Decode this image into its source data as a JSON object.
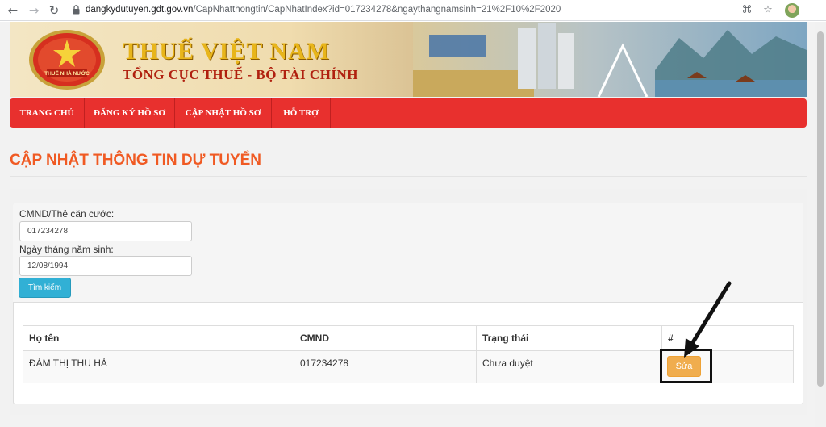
{
  "browser": {
    "url_host": "dangkydutuyen.gdt.gov.vn",
    "url_path": "/CapNhatthongtin/CapNhatIndex?id=017234278&ngaythangnamsinh=21%2F10%2F2020"
  },
  "header": {
    "seal_text": "THUẾ NHÀ NƯỚC",
    "brand": "THUẾ VIỆT NAM",
    "subtitle": "TỔNG CỤC THUẾ - BỘ TÀI CHÍNH"
  },
  "nav": {
    "items": [
      {
        "label": "TRANG CHỦ"
      },
      {
        "label": "ĐĂNG KÝ HỒ SƠ"
      },
      {
        "label": "CẬP NHẬT HỒ SƠ"
      },
      {
        "label": "HỖ TRỢ"
      }
    ]
  },
  "page_title": "CẬP NHẬT THÔNG TIN DỰ TUYỂN",
  "form": {
    "id_label": "CMND/Thẻ căn cước:",
    "id_value": "017234278",
    "dob_label": "Ngày tháng năm sinh:",
    "dob_value": "12/08/1994",
    "search_label": "Tìm kiếm"
  },
  "table": {
    "headers": [
      "Họ tên",
      "CMND",
      "Trạng thái",
      "#"
    ],
    "rows": [
      {
        "name": "ĐÀM THỊ THU HÀ",
        "id": "017234278",
        "status": "Chưa duyệt",
        "action": "Sửa"
      }
    ]
  },
  "colors": {
    "nav_bg": "#e8302e",
    "title": "#f05a23",
    "search_button": "#31b0d5",
    "edit_button": "#f0ad4e"
  },
  "icons": [
    "back-icon",
    "forward-icon",
    "reload-icon",
    "lock-icon",
    "translate-icon",
    "star-icon",
    "arrow-annotation"
  ]
}
